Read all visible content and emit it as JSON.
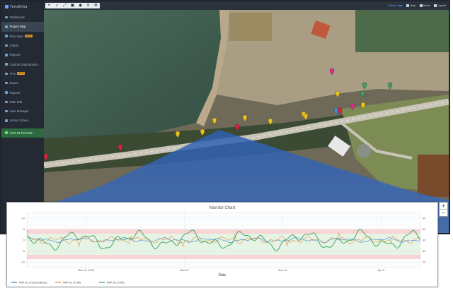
{
  "app": {
    "logo": "Terrafirma"
  },
  "sidebar": {
    "items": [
      {
        "label": "Dashboard",
        "icon": "dashboard-icon",
        "active": false
      },
      {
        "label": "Project Map",
        "icon": "map-icon",
        "active": true
      },
      {
        "label": "Plan View",
        "icon": "layers-icon",
        "badge": "NEW"
      },
      {
        "label": "Charts",
        "icon": "chart-icon"
      },
      {
        "label": "Reports",
        "icon": "report-icon"
      },
      {
        "label": "Custom Data Monitor",
        "icon": "monitor-icon"
      },
      {
        "label": "TPS",
        "icon": "tps-icon",
        "badge": "NEW"
      },
      {
        "label": "Export",
        "icon": "export-icon"
      },
      {
        "label": "Reports",
        "icon": "report-icon"
      },
      {
        "label": "Data Edit",
        "icon": "edit-icon"
      },
      {
        "label": "User Manager",
        "icon": "users-icon"
      },
      {
        "label": "Sensor Status",
        "icon": "status-icon"
      }
    ],
    "footer_item": {
      "label": "LOG IN TO SAM",
      "icon": "login-icon"
    }
  },
  "toolbar": {
    "tools": [
      {
        "name": "select-tool",
        "glyph": "⌖"
      },
      {
        "name": "zoom-tool",
        "glyph": "⌕"
      },
      {
        "name": "extent-tool",
        "glyph": "⤢"
      },
      {
        "name": "print-tool",
        "glyph": "▣"
      },
      {
        "name": "layer-tool",
        "glyph": "◆"
      },
      {
        "name": "measure-tool",
        "glyph": "✕"
      },
      {
        "name": "settings-tool",
        "glyph": "⚙"
      }
    ],
    "user_links": [
      "Client Login",
      "Help",
      "Alerts",
      "Logout"
    ]
  },
  "map": {
    "zoom_in": "+",
    "zoom_out": "−",
    "colors": {
      "water": "#3f5e4f",
      "shore": "#b9a88a",
      "road": "#c9c4b8",
      "field": "#7d8b54"
    }
  },
  "chart_data": {
    "type": "line",
    "title": "Monitor Chart",
    "xlabel": "Date",
    "x_ticks": [
      "Mar 15, 2020",
      "Mar 22",
      "Mar 29",
      "Apr 5"
    ],
    "y_left_ticks": [
      "-10",
      "-5",
      "0",
      "5",
      "10"
    ],
    "y_right_ticks": [
      "20",
      "30",
      "40",
      "50",
      "60"
    ],
    "grid": true,
    "legend_position": "bottom-left",
    "series": [
      {
        "name": "TMP-01 (Temperature)",
        "color": "#3d7fc9"
      },
      {
        "name": "TMP-01 (X-tilt)",
        "color": "#e8923a"
      },
      {
        "name": "TMP-01 (Y-tilt)",
        "color": "#3aa05a"
      }
    ]
  }
}
